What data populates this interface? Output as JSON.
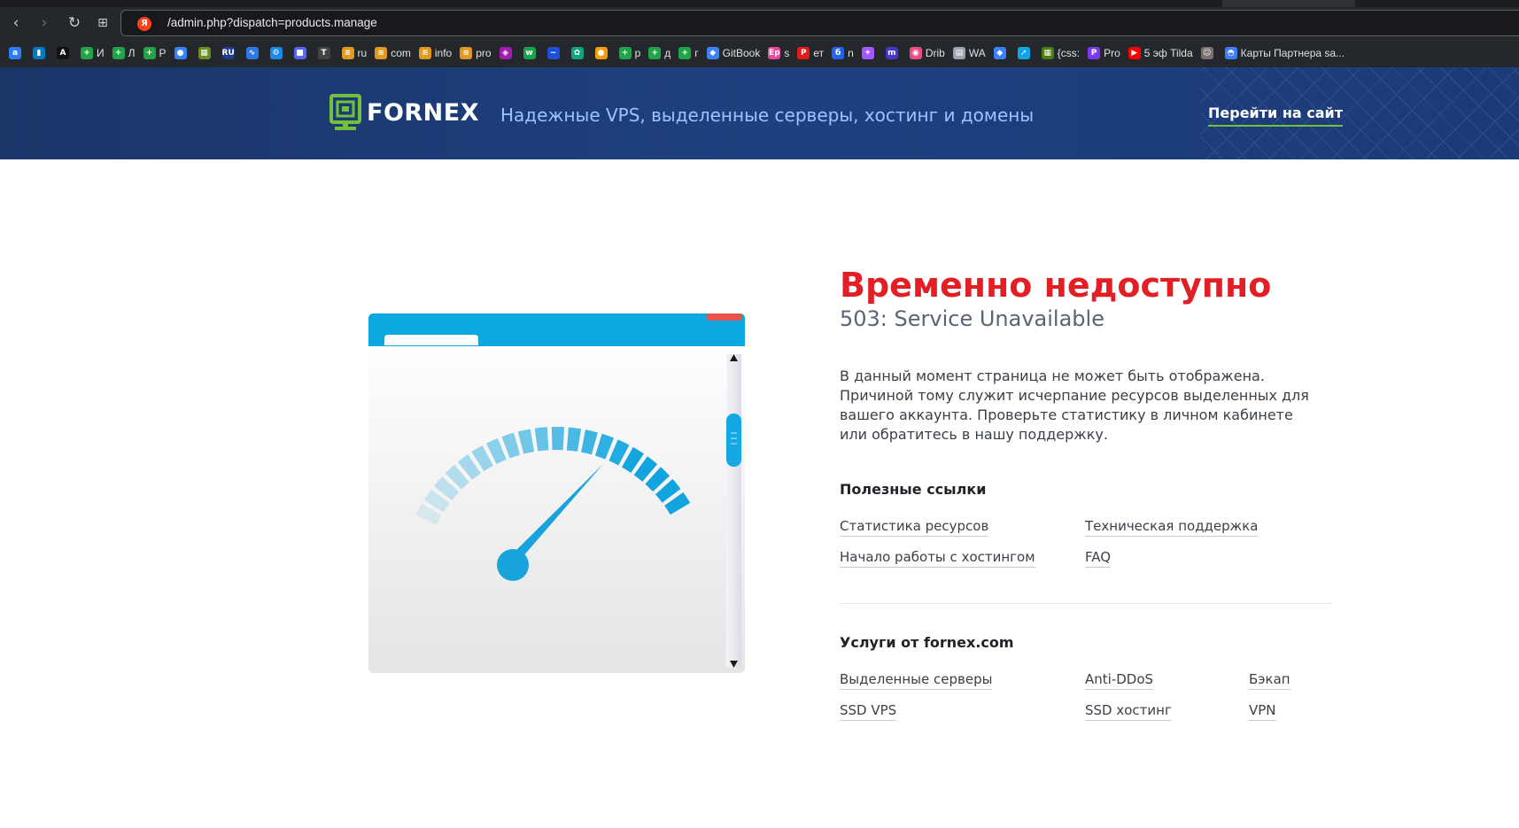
{
  "browser": {
    "url": "/admin.php?dispatch=products.manage",
    "search_badge": "Я",
    "bookmarks": [
      {
        "label": "",
        "icon": "a-icon",
        "color": "#2d7cf6",
        "glyph": "a"
      },
      {
        "label": "",
        "icon": "trello-icon",
        "color": "#0079bf",
        "glyph": "▮"
      },
      {
        "label": "",
        "icon": "a-black-icon",
        "color": "#111111",
        "glyph": "A"
      },
      {
        "label": "И",
        "icon": "plus-green-icon",
        "color": "#22a34a",
        "glyph": "+"
      },
      {
        "label": "Л",
        "icon": "plus-green-icon",
        "color": "#22a34a",
        "glyph": "+"
      },
      {
        "label": "Р",
        "icon": "plus-green-icon",
        "color": "#22a34a",
        "glyph": "+"
      },
      {
        "label": "",
        "icon": "pin-icon",
        "color": "#3b82f6",
        "glyph": "●"
      },
      {
        "label": "",
        "icon": "sheet-icon",
        "color": "#6b8e23",
        "glyph": "▦"
      },
      {
        "label": "",
        "icon": "ru-icon",
        "color": "#1e3a8a",
        "glyph": "RU"
      },
      {
        "label": "",
        "icon": "pulse-icon",
        "color": "#2c7be5",
        "glyph": "∿"
      },
      {
        "label": "",
        "icon": "gear-icon",
        "color": "#1e88e5",
        "glyph": "⚙"
      },
      {
        "label": "",
        "icon": "discord-icon",
        "color": "#5865f2",
        "glyph": "■"
      },
      {
        "label": "",
        "icon": "t-circle-icon",
        "color": "#444444",
        "glyph": "T"
      },
      {
        "label": "ru",
        "icon": "stack-icon",
        "color": "#e09a1f",
        "glyph": "≋"
      },
      {
        "label": "com",
        "icon": "stack-icon",
        "color": "#e09a1f",
        "glyph": "≋"
      },
      {
        "label": "info",
        "icon": "stack-icon",
        "color": "#e09a1f",
        "glyph": "≋"
      },
      {
        "label": "pro",
        "icon": "stack-icon",
        "color": "#e09a1f",
        "glyph": "≋"
      },
      {
        "label": "",
        "icon": "shape-icon",
        "color": "#a21caf",
        "glyph": "◈"
      },
      {
        "label": "",
        "icon": "w2-icon",
        "color": "#16a34a",
        "glyph": "w"
      },
      {
        "label": "",
        "icon": "wave-icon",
        "color": "#1d4ed8",
        "glyph": "~"
      },
      {
        "label": "",
        "icon": "openai-icon",
        "color": "#10a37f",
        "glyph": "✿"
      },
      {
        "label": "",
        "icon": "chrome-icon",
        "color": "#f59e0b",
        "glyph": "●"
      },
      {
        "label": "р",
        "icon": "plus-green-icon",
        "color": "#22a34a",
        "glyph": "+"
      },
      {
        "label": "д",
        "icon": "plus-green-icon",
        "color": "#22a34a",
        "glyph": "+"
      },
      {
        "label": "г",
        "icon": "plus-green-icon",
        "color": "#22a34a",
        "glyph": "+"
      },
      {
        "label": "GitBook",
        "icon": "gitbook-icon",
        "color": "#3884ff",
        "glyph": "◆"
      },
      {
        "label": "s",
        "icon": "pink-icon",
        "color": "#ec4899",
        "glyph": "Ep"
      },
      {
        "label": "ет",
        "icon": "rzd-icon",
        "color": "#e21a1a",
        "glyph": "РЖД"
      },
      {
        "label": "n",
        "icon": "b-icon",
        "color": "#2563eb",
        "glyph": "б"
      },
      {
        "label": "",
        "icon": "figma-icon",
        "color": "#a259ff",
        "glyph": "✦"
      },
      {
        "label": "",
        "icon": "m-icon",
        "color": "#4338ca",
        "glyph": "m"
      },
      {
        "label": "Drib",
        "icon": "dribbble-icon",
        "color": "#ea4c89",
        "glyph": "◉"
      },
      {
        "label": "WA",
        "icon": "printer-icon",
        "color": "#9ca3af",
        "glyph": "▤"
      },
      {
        "label": "",
        "icon": "drop-icon",
        "color": "#3b82f6",
        "glyph": "◆"
      },
      {
        "label": "",
        "icon": "arrow-icon",
        "color": "#0ea5e9",
        "glyph": "➚"
      },
      {
        "label": "{css:",
        "icon": "css-icon",
        "color": "#4d7c0f",
        "glyph": "▦"
      },
      {
        "label": "Pro",
        "icon": "p-icon",
        "color": "#7c3aed",
        "glyph": "P"
      },
      {
        "label": "5 эф Tilda",
        "icon": "youtube-icon",
        "color": "#ff0000",
        "glyph": "▶"
      },
      {
        "label": "",
        "icon": "avatar-icon",
        "color": "#78716c",
        "glyph": "☺"
      },
      {
        "label": "Карты Партнера sa...",
        "icon": "card-icon",
        "color": "#3b82f6",
        "glyph": "◓"
      }
    ]
  },
  "header": {
    "logo_text": "FORNEX",
    "tagline": "Надежные VPS, выделенные серверы, хостинг и домены",
    "goto_label": "Перейти на сайт",
    "brand_green": "#71c13d"
  },
  "error": {
    "title": "Временно недоступно",
    "code": "503: Service Unavailable",
    "description": "В данный момент страница не может быть отображена. Причиной тому служит исчерпание ресурсов выделенных для вашего аккаунта. Проверьте статистику в личном кабинете или обратитесь в нашу поддержку.",
    "accent": "#e31e24"
  },
  "useful_links": {
    "title": "Полезные ссылки",
    "items": [
      "Статистика ресурсов",
      "Техническая поддержка",
      "Начало работы с хостингом",
      "FAQ"
    ]
  },
  "services": {
    "title": "Услуги от fornex.com",
    "items": [
      "Выделенные серверы",
      "Anti-DDoS",
      "Бэкап",
      "SSD VPS",
      "SSD хостинг",
      "VPN"
    ]
  }
}
